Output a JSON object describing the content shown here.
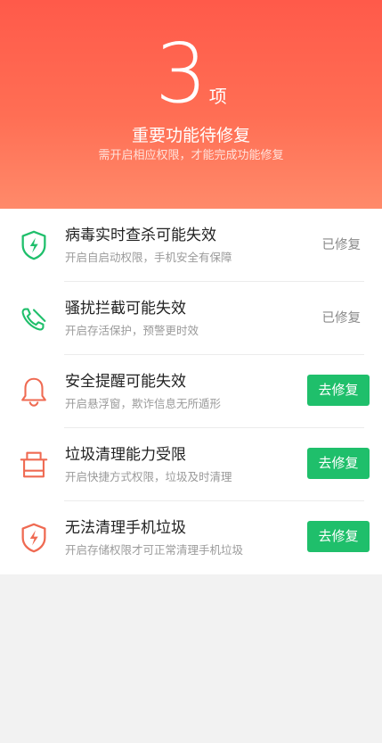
{
  "header": {
    "count": "3",
    "count_unit": "项",
    "title": "重要功能待修复",
    "subtitle": "需开启相应权限，才能完成功能修复"
  },
  "colors": {
    "header_top": "#ff5a4a",
    "header_bottom": "#ff8a6a",
    "green": "#1fbf6b",
    "red": "#ef6a52"
  },
  "items": [
    {
      "icon": "shield-lightning-icon",
      "title": "病毒实时查杀可能失效",
      "desc": "开启自启动权限，手机安全有保障",
      "status": "已修复",
      "fixed": true
    },
    {
      "icon": "phone-blocked-icon",
      "title": "骚扰拦截可能失效",
      "desc": "开启存活保护，预警更时效",
      "status": "已修复",
      "fixed": true
    },
    {
      "icon": "bell-icon",
      "title": "安全提醒可能失效",
      "desc": "开启悬浮窗，欺诈信息无所遁形",
      "action": "去修复",
      "fixed": false
    },
    {
      "icon": "trash-bin-icon",
      "title": "垃圾清理能力受限",
      "desc": "开启快捷方式权限，垃圾及时清理",
      "action": "去修复",
      "fixed": false
    },
    {
      "icon": "shield-lightning-icon",
      "title": "无法清理手机垃圾",
      "desc": "开启存储权限才可正常清理手机垃圾",
      "action": "去修复",
      "fixed": false
    }
  ]
}
